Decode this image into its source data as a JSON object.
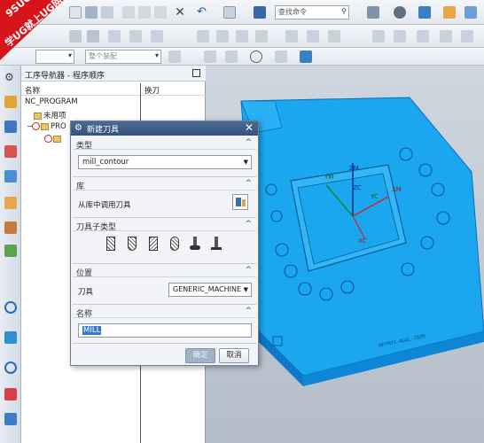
{
  "watermark": {
    "line1": "9SUG",
    "line2": "学UG就上UG网"
  },
  "toolbar": {
    "command_finder_placeholder": "查找命令",
    "filter_placeholder": "整个装配"
  },
  "navigator": {
    "title": "工序导航器 - 程序顺序",
    "columns": {
      "name": "名称",
      "tool_change": "换刀"
    },
    "tree": [
      {
        "label": "NC_PROGRAM"
      },
      {
        "label": "未用项"
      },
      {
        "label": "PRO"
      }
    ]
  },
  "dialog": {
    "title": "新建刀具",
    "sections": {
      "type": {
        "label": "类型",
        "value": "mill_contour"
      },
      "library": {
        "label": "库",
        "call_from_library": "从库中调用刀具"
      },
      "subtype": {
        "label": "刀具子类型"
      },
      "location": {
        "label": "位置",
        "tool_label": "刀具",
        "tool_value": "GENERIC_MACHINE"
      },
      "name": {
        "label": "名称",
        "value": "MILL"
      }
    },
    "buttons": {
      "ok": "确定",
      "cancel": "取消"
    }
  },
  "viewport": {
    "axis_labels": [
      "ZM",
      "YM",
      "ZC",
      "YC",
      "XM",
      "XC"
    ],
    "part_engraving": "MP7M71-AGGL-702M"
  },
  "colors": {
    "part": "#1aa7f0",
    "titlebar": "#3f5f8a",
    "watermark": "#d8141b"
  }
}
